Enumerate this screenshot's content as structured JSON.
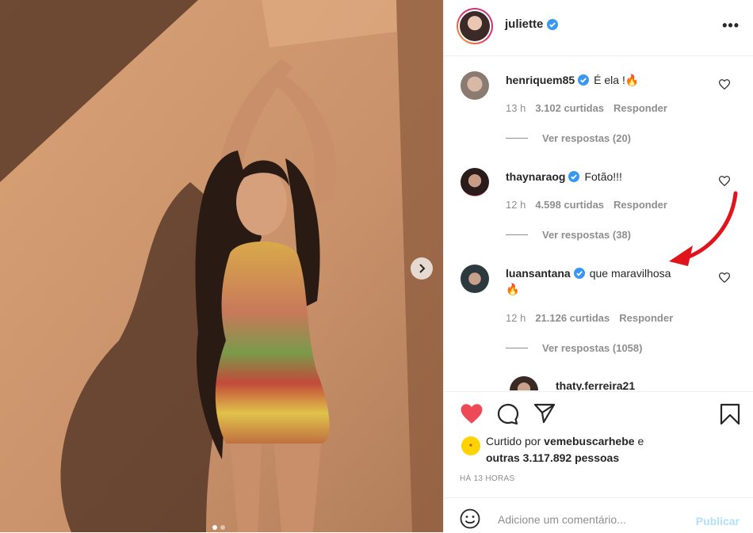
{
  "post": {
    "username": "juliette",
    "more_label": "•••"
  },
  "comments": [
    {
      "username": "henriquem85",
      "text": "É ela !🔥",
      "time": "13 h",
      "likes": "3.102 curtidas",
      "reply_label": "Responder",
      "view_replies": "Ver respostas (20)"
    },
    {
      "username": "thaynaraog",
      "text": "Fotão!!!",
      "time": "12 h",
      "likes": "4.598 curtidas",
      "reply_label": "Responder",
      "view_replies": "Ver respostas (38)"
    },
    {
      "username": "luansantana",
      "text": "que maravilhosa",
      "emoji": "🔥",
      "time": "12 h",
      "likes": "21.126 curtidas",
      "reply_label": "Responder",
      "view_replies": "Ver respostas (1058)"
    }
  ],
  "partial_reply_username": "thaty.ferreira21",
  "likes": {
    "prefix": "Curtido por",
    "user": "vemebuscarhebe",
    "conjunction": "e",
    "others": "outras 3.117.892 pessoas"
  },
  "timestamp": "HÁ 13 HORAS",
  "comment_box": {
    "placeholder": "Adicione um comentário...",
    "publish_label": "Publicar"
  },
  "colors": {
    "heart": "#ed4956",
    "verified": "#3897f0",
    "publish": "#b2dffc",
    "annotation_arrow": "#e0141a"
  }
}
